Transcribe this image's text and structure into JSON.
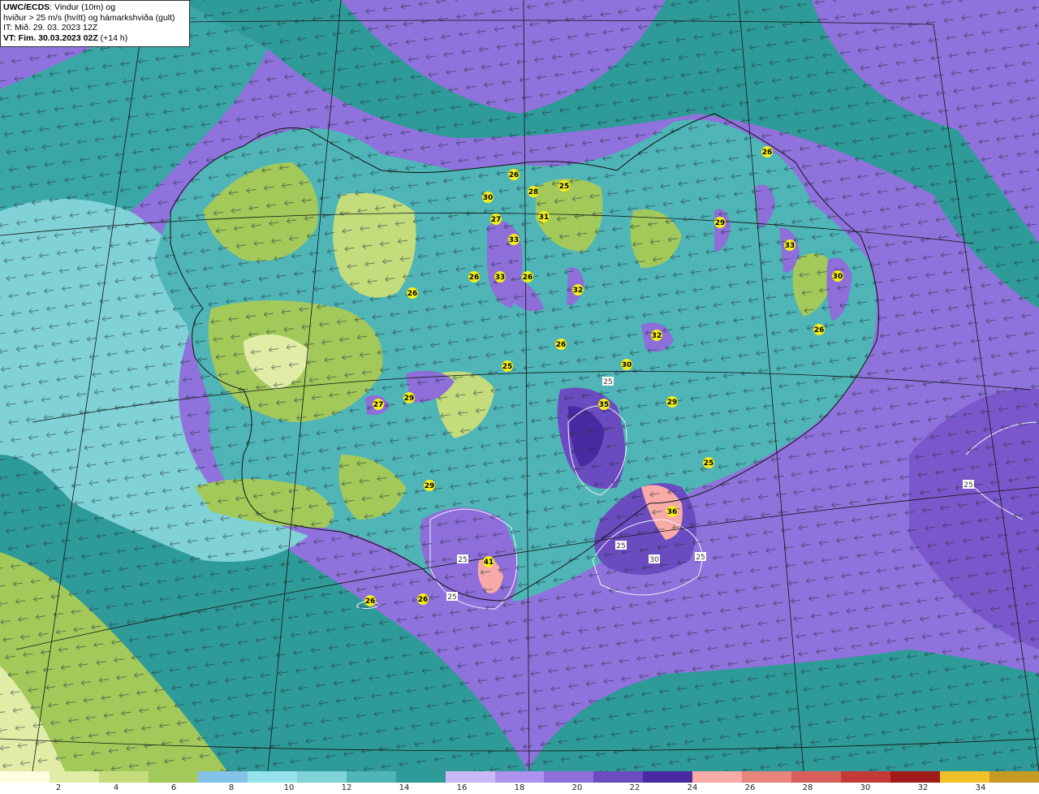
{
  "header": {
    "line1_bold": "UWC/ECDS",
    "line1_rest": ": Vindur (10m) og",
    "line2": "hviður > 25 m/s (hvítt) og hámarkshviða (gult)",
    "line3": "IT: Mið. 29. 03. 2023 12Z",
    "line4_bold": "VT: Fim. 30.03.2023 02Z",
    "line4_rest": " (+14 h)"
  },
  "legend": {
    "colors": [
      "#fdfde0",
      "#e1eda6",
      "#c4dc7c",
      "#a3c95a",
      "#83c3e8",
      "#96e2ea",
      "#80d2d6",
      "#4fb5b6",
      "#2f9b98",
      "#c9b9f6",
      "#ad93ed",
      "#8e6ed9",
      "#6b4cc0",
      "#4a2aa1",
      "#f8aaa6",
      "#e8847c",
      "#d9605a",
      "#c43a36",
      "#9e1b1a",
      "#f0c02a",
      "#c79a22"
    ],
    "ticks": [
      "2",
      "4",
      "6",
      "8",
      "10",
      "12",
      "14",
      "16",
      "18",
      "20",
      "22",
      "24",
      "26",
      "28",
      "30",
      "32",
      "34"
    ]
  },
  "gust_markers": [
    {
      "label": "26"
    },
    {
      "label": "30"
    },
    {
      "label": "28"
    },
    {
      "label": "25"
    },
    {
      "label": "27"
    },
    {
      "label": "31"
    },
    {
      "label": "33"
    },
    {
      "label": "26"
    },
    {
      "label": "33"
    },
    {
      "label": "26"
    },
    {
      "label": "32"
    },
    {
      "label": "26"
    },
    {
      "label": "26"
    },
    {
      "label": "25"
    },
    {
      "label": "27"
    },
    {
      "label": "29"
    },
    {
      "label": "30"
    },
    {
      "label": "32"
    },
    {
      "label": "35"
    },
    {
      "label": "29"
    },
    {
      "label": "29"
    },
    {
      "label": "33"
    },
    {
      "label": "30"
    },
    {
      "label": "26"
    },
    {
      "label": "26"
    },
    {
      "label": "25"
    },
    {
      "label": "36"
    },
    {
      "label": "41"
    },
    {
      "label": "26"
    },
    {
      "label": "26"
    },
    {
      "label": "29"
    }
  ],
  "white_contour_labels": [
    {
      "label": "25"
    },
    {
      "label": "25"
    },
    {
      "label": "25"
    },
    {
      "label": "30"
    },
    {
      "label": "25"
    },
    {
      "label": "25"
    },
    {
      "label": "25"
    }
  ]
}
